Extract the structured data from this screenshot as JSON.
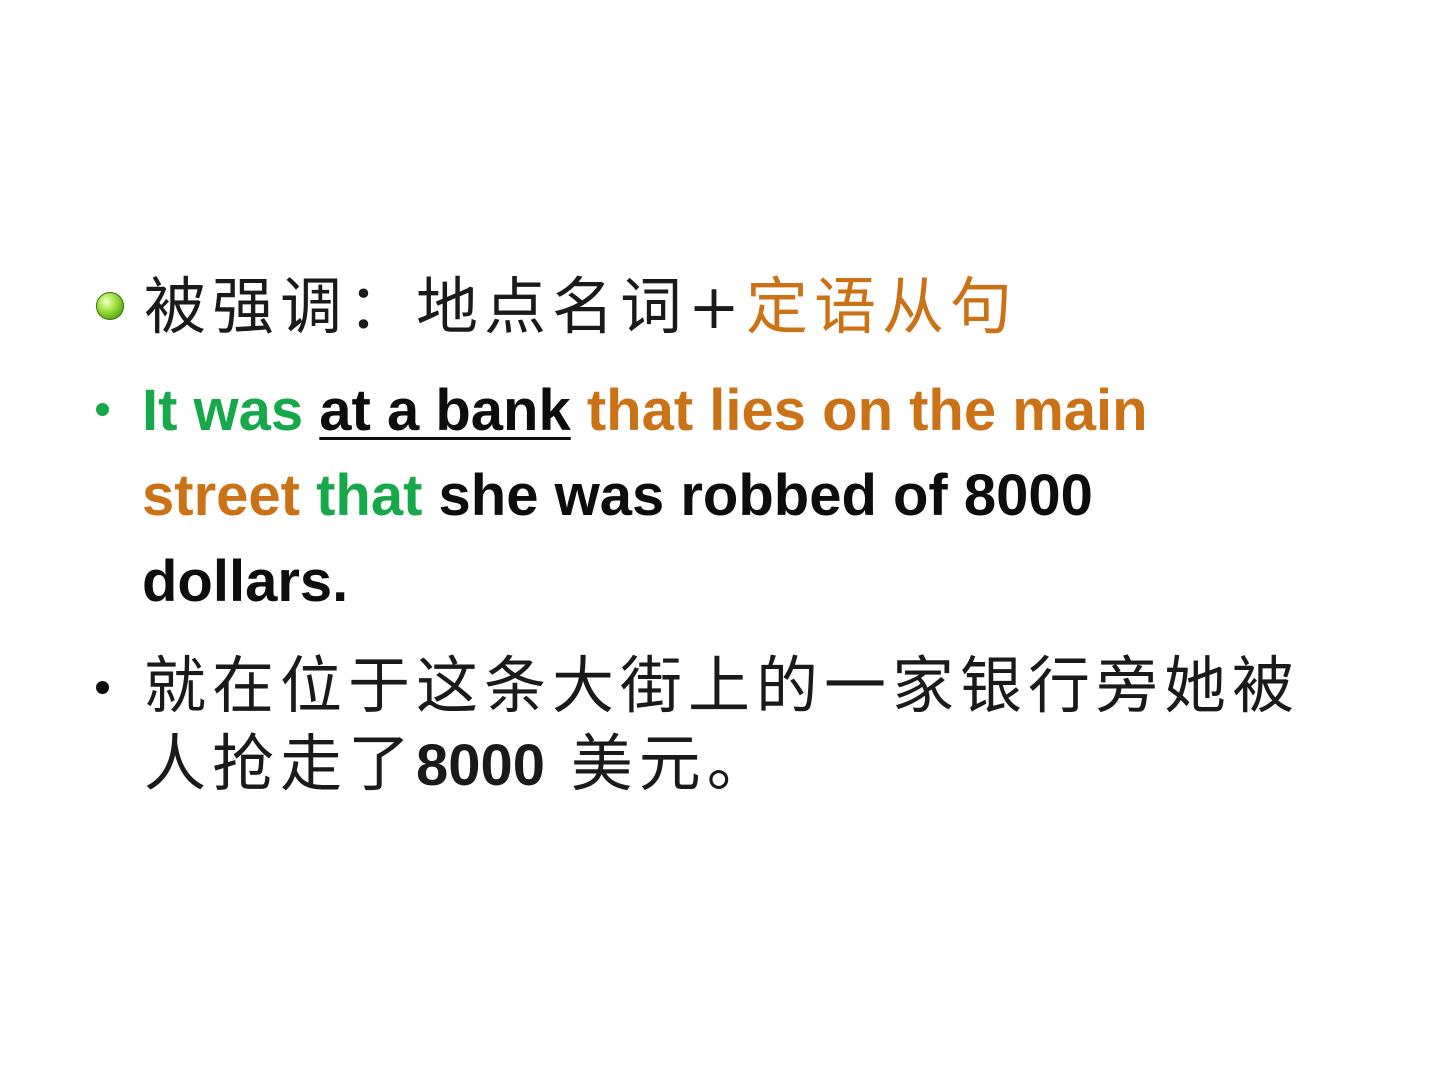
{
  "colors": {
    "green": "#16a84a",
    "orange": "#cc7216",
    "black": "#0d0d0d",
    "bullet_orb": "#6fbf1d"
  },
  "heading": {
    "prefix": "被强调：地点名词+",
    "highlight": "定语从句"
  },
  "example": {
    "lead": "It was ",
    "emphasized": "at a bank",
    "clause_line1": " that lies on the main",
    "clause_line2": "street ",
    "that2": "that",
    "rest_line2": " she was robbed of 8000",
    "line3": "dollars."
  },
  "translation": {
    "line1": "就在位于这条大街上的一家银行旁她被",
    "line2_cn_a": "人抢走了",
    "line2_num": "8000",
    "line2_cn_b": "  美元。"
  }
}
